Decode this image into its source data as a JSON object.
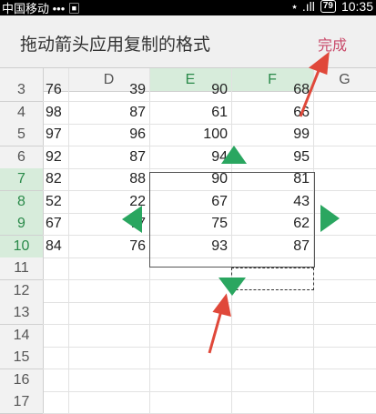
{
  "statusbar": {
    "carrier": "中国移动 ••• ▣",
    "signal": "⋆ .ıll",
    "battery": "79",
    "time": "10:35"
  },
  "toolbar": {
    "title": "拖动箭头应用复制的格式",
    "done_label": "完成"
  },
  "columns": [
    {
      "label": "D",
      "selected": false
    },
    {
      "label": "E",
      "selected": true
    },
    {
      "label": "F",
      "selected": true
    },
    {
      "label": "G",
      "selected": false
    }
  ],
  "rows": [
    {
      "num": "3",
      "cells": [
        "76",
        "39",
        "90",
        "68"
      ],
      "selected": false
    },
    {
      "num": "4",
      "cells": [
        "98",
        "87",
        "61",
        "66"
      ],
      "selected": false
    },
    {
      "num": "5",
      "cells": [
        "97",
        "96",
        "100",
        "99"
      ],
      "selected": false
    },
    {
      "num": "6",
      "cells": [
        "92",
        "87",
        "94",
        "95"
      ],
      "selected": false
    },
    {
      "num": "7",
      "cells": [
        "82",
        "88",
        "90",
        "81"
      ],
      "selected": true
    },
    {
      "num": "8",
      "cells": [
        "52",
        "22",
        "67",
        "43"
      ],
      "selected": true
    },
    {
      "num": "9",
      "cells": [
        "67",
        "77",
        "75",
        "62"
      ],
      "selected": true
    },
    {
      "num": "10",
      "cells": [
        "84",
        "76",
        "93",
        "87"
      ],
      "selected": true
    },
    {
      "num": "11",
      "cells": [
        "",
        "",
        "",
        ""
      ],
      "selected": false
    },
    {
      "num": "12",
      "cells": [
        "",
        "",
        "",
        ""
      ],
      "selected": false
    },
    {
      "num": "13",
      "cells": [
        "",
        "",
        "",
        ""
      ],
      "selected": false
    },
    {
      "num": "14",
      "cells": [
        "",
        "",
        "",
        ""
      ],
      "selected": false
    },
    {
      "num": "15",
      "cells": [
        "",
        "",
        "",
        ""
      ],
      "selected": false
    },
    {
      "num": "16",
      "cells": [
        "",
        "",
        "",
        ""
      ],
      "selected": false
    },
    {
      "num": "17",
      "cells": [
        "",
        "",
        "",
        ""
      ],
      "selected": false
    }
  ],
  "colors": {
    "accent_green": "#2aa660",
    "annotation_red": "#e0483a",
    "done_pink": "#c94a6a"
  }
}
